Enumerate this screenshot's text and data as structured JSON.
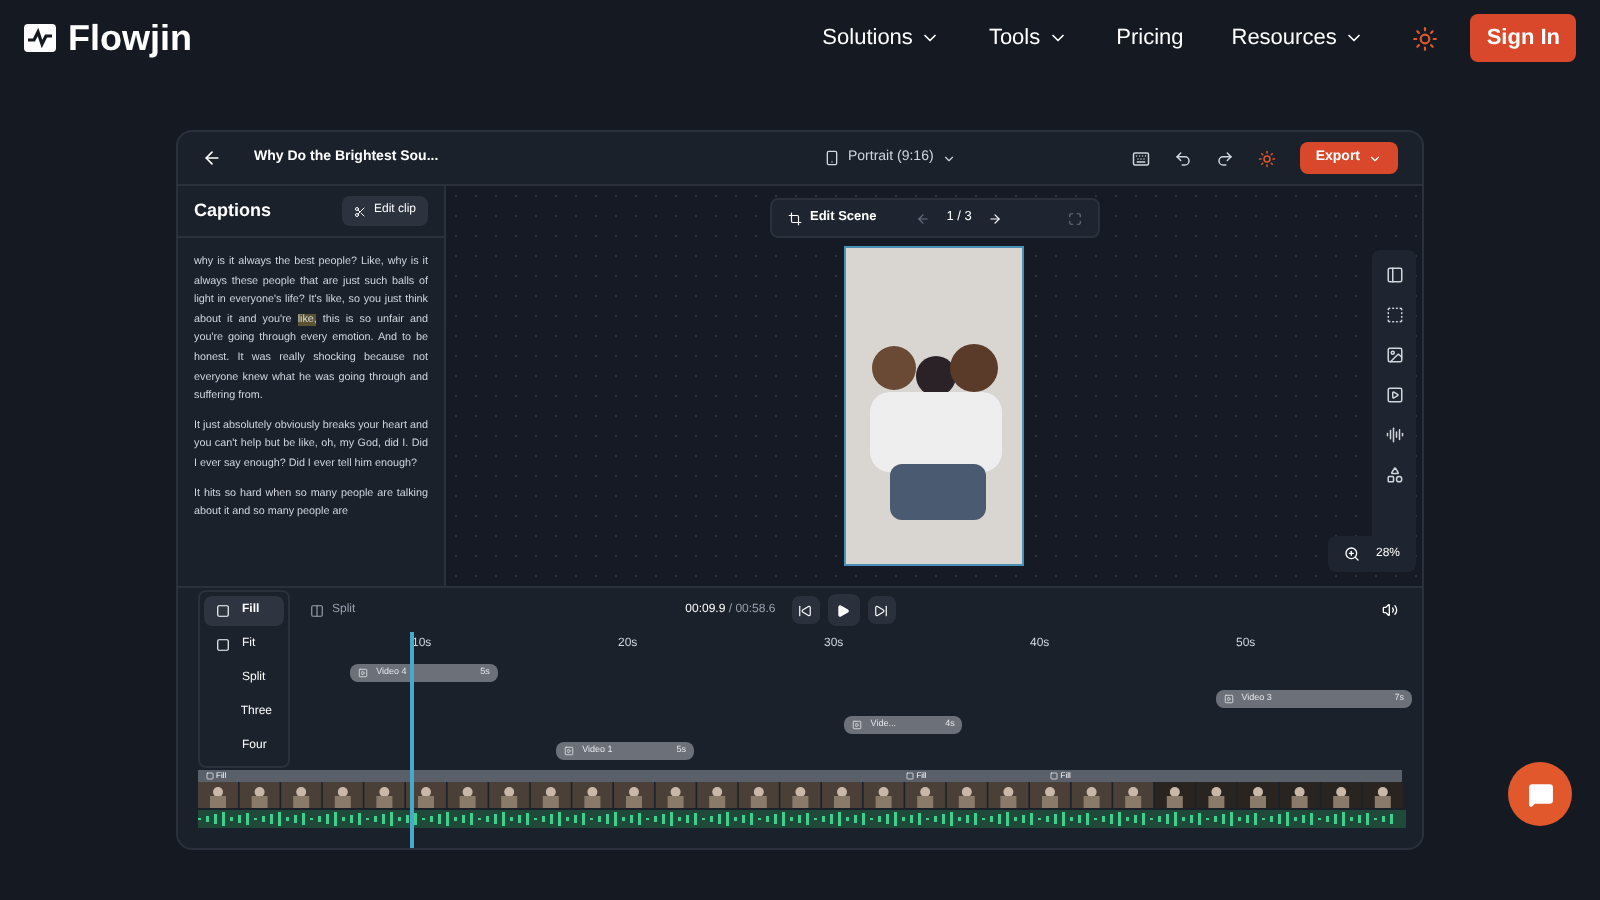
{
  "nav": {
    "brand": "Flowjin",
    "menu": [
      {
        "label": "Solutions",
        "dropdown": true
      },
      {
        "label": "Tools",
        "dropdown": true
      },
      {
        "label": "Pricing",
        "dropdown": false
      },
      {
        "label": "Resources",
        "dropdown": true
      }
    ],
    "signin": "Sign In"
  },
  "editor": {
    "title": "Why Do the Brightest Sou...",
    "format": "Portrait (9:16)",
    "export": "Export",
    "captions": {
      "heading": "Captions",
      "edit_clip": "Edit clip",
      "paragraphs": [
        [
          {
            "text": "why is it always the best people? Like, why is it always these people that are just such balls of light in everyone's life? It's like, so you just think about it and you're ",
            "highlighted": false
          },
          {
            "text": "like,",
            "highlighted": true
          },
          {
            "text": " this is so unfair and you're going through every emotion. And to be honest. It was really shocking because not everyone knew what he was going through and suffering from.",
            "highlighted": false
          }
        ],
        [
          {
            "text": "It just absolutely obviously breaks your heart and you can't help but be like, oh, my God, did I. Did I ever say enough? Did I ever tell him enough?",
            "highlighted": false
          }
        ],
        [
          {
            "text": "It hits so hard when so many people are talking about it and so many people are",
            "highlighted": false
          }
        ]
      ]
    },
    "scene": {
      "label": "Edit Scene",
      "page": "1 / 3"
    },
    "zoom": "28%",
    "timeline": {
      "split": "Split",
      "time": "00:09.9",
      "duration": "/ 00:58.6",
      "ticks": [
        "10s",
        "20s",
        "30s",
        "40s",
        "50s"
      ],
      "clips": [
        {
          "name": "Video 4",
          "length": "5s"
        },
        {
          "name": "Video 3",
          "length": "7s"
        },
        {
          "name": "Vide...",
          "length": "4s"
        },
        {
          "name": "Video 1",
          "length": "5s"
        }
      ],
      "segments": [
        "Fill",
        "Fill",
        "Fill"
      ],
      "layout_menu": [
        {
          "label": "Fill",
          "icon": true,
          "selected": true
        },
        {
          "label": "Fit",
          "icon": true,
          "selected": false
        },
        {
          "label": "Split",
          "icon": false,
          "selected": false
        },
        {
          "label": "Three",
          "icon": false,
          "selected": false
        },
        {
          "label": "Four",
          "icon": false,
          "selected": false
        }
      ]
    }
  }
}
